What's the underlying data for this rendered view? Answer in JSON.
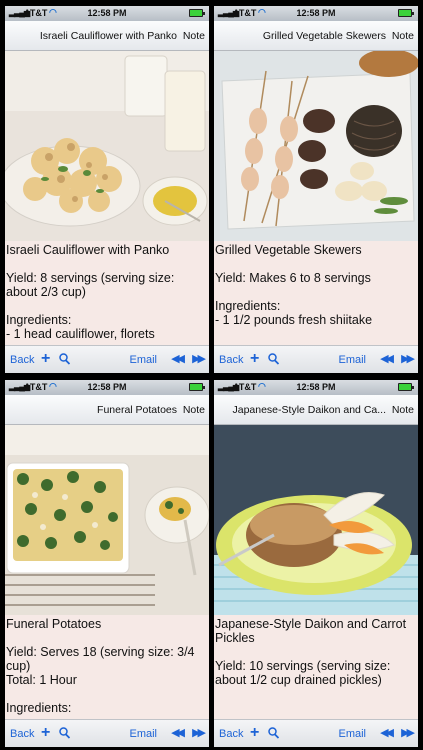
{
  "status_bar": {
    "carrier": "AT&T",
    "time": "12:58 PM"
  },
  "toolbar": {
    "back_label": "Back",
    "plus_label": "+",
    "email_label": "Email",
    "prev_label": "◀◀",
    "next_label": "▶▶"
  },
  "nav": {
    "note_label": "Note"
  },
  "panels": [
    {
      "title": "Israeli Cauliflower with Panko",
      "body_title": "Israeli Cauliflower with Panko",
      "yield": "Yield: 8 servings (serving size: about 2/3 cup)",
      "extra1": "",
      "extra2": "Ingredients:",
      "extra3": "- 1 head cauliflower, florets"
    },
    {
      "title": "Grilled Vegetable Skewers",
      "body_title": "Grilled Vegetable Skewers",
      "yield": "Yield: Makes 6 to 8 servings",
      "extra1": "",
      "extra2": "Ingredients:",
      "extra3": "- 1 1/2 pounds fresh shiitake"
    },
    {
      "title": "Funeral Potatoes",
      "body_title": "Funeral Potatoes",
      "yield": "Yield: Serves 18 (serving size: 3/4 cup)",
      "extra1": "Total: 1 Hour",
      "extra2": "",
      "extra3": "Ingredients:"
    },
    {
      "title": "Japanese-Style Daikon and Ca...",
      "body_title": "Japanese-Style Daikon and Carrot Pickles",
      "yield": "Yield: 10 servings (serving size: about 1/2 cup drained pickles)",
      "extra1": "",
      "extra2": "",
      "extra3": ""
    }
  ]
}
